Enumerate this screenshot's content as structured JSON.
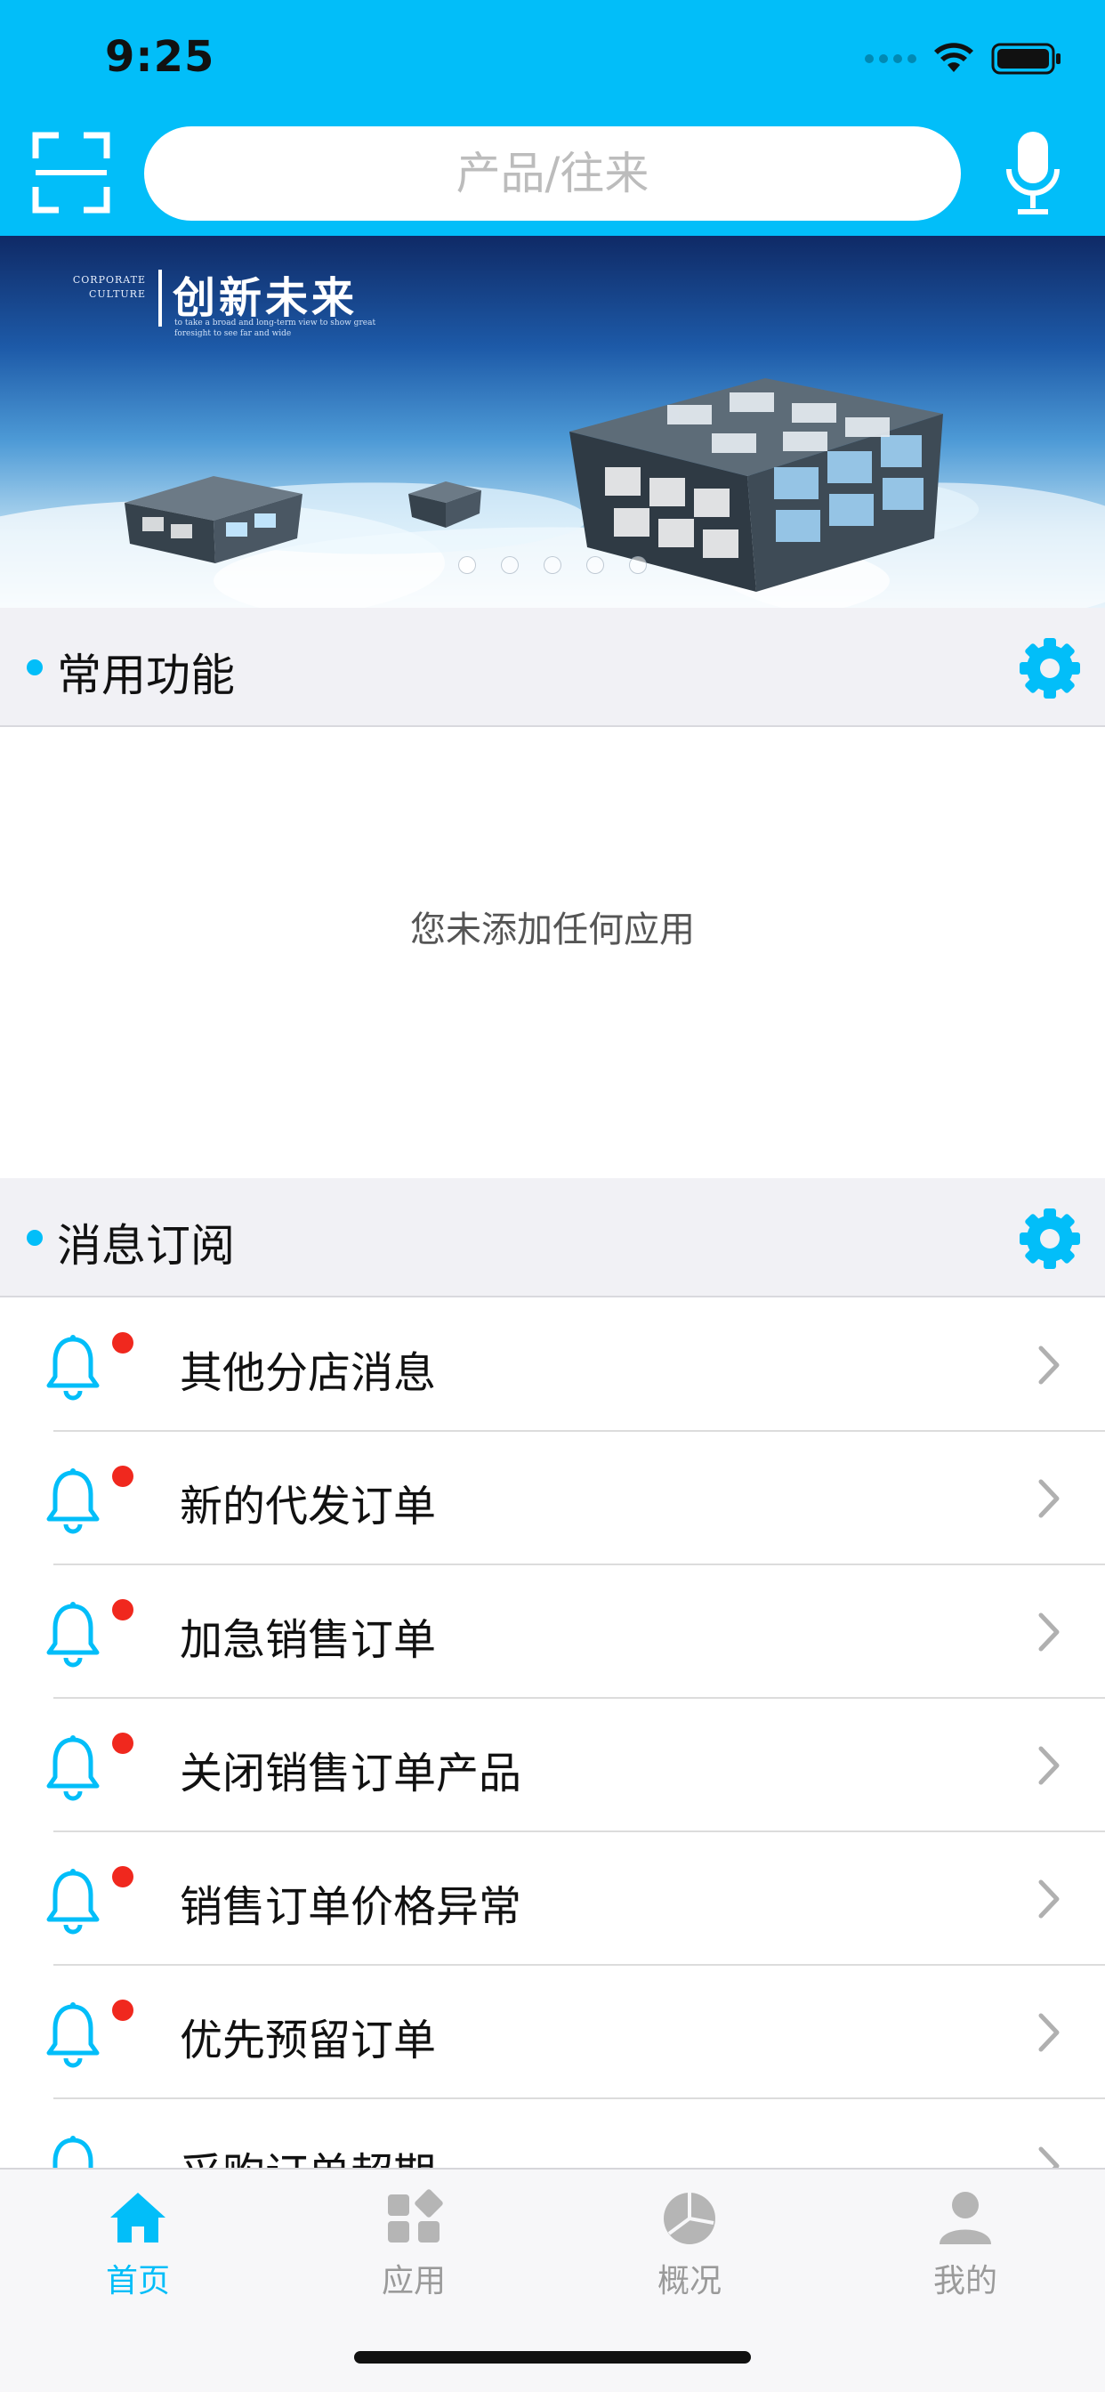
{
  "status_bar": {
    "time": "9:25"
  },
  "header": {
    "search_placeholder": "产品/往来",
    "scan_icon": "scan-icon",
    "mic_icon": "microphone-icon",
    "accent_color": "#02BEF9"
  },
  "banner": {
    "title": "创新未来",
    "small_caption_1": "CORPORATE",
    "small_caption_2": "CULTURE",
    "subtitle": "to take a broad and long-term view to show great foresight to see far and wide",
    "page_count": 5,
    "active_page": 1
  },
  "common_functions": {
    "title": "常用功能",
    "empty_message": "您未添加任何应用"
  },
  "subscriptions": {
    "title": "消息订阅",
    "items": [
      {
        "label": "其他分店消息",
        "unread": true
      },
      {
        "label": "新的代发订单",
        "unread": true
      },
      {
        "label": "加急销售订单",
        "unread": true
      },
      {
        "label": "关闭销售订单产品",
        "unread": true
      },
      {
        "label": "销售订单价格异常",
        "unread": true
      },
      {
        "label": "优先预留订单",
        "unread": true
      },
      {
        "label": "采购订单超期",
        "unread": false
      }
    ]
  },
  "tabbar": {
    "tabs": [
      {
        "label": "首页",
        "icon": "home-icon",
        "active": true
      },
      {
        "label": "应用",
        "icon": "apps-icon",
        "active": false
      },
      {
        "label": "概况",
        "icon": "pie-chart-icon",
        "active": false
      },
      {
        "label": "我的",
        "icon": "user-icon",
        "active": false
      }
    ]
  }
}
